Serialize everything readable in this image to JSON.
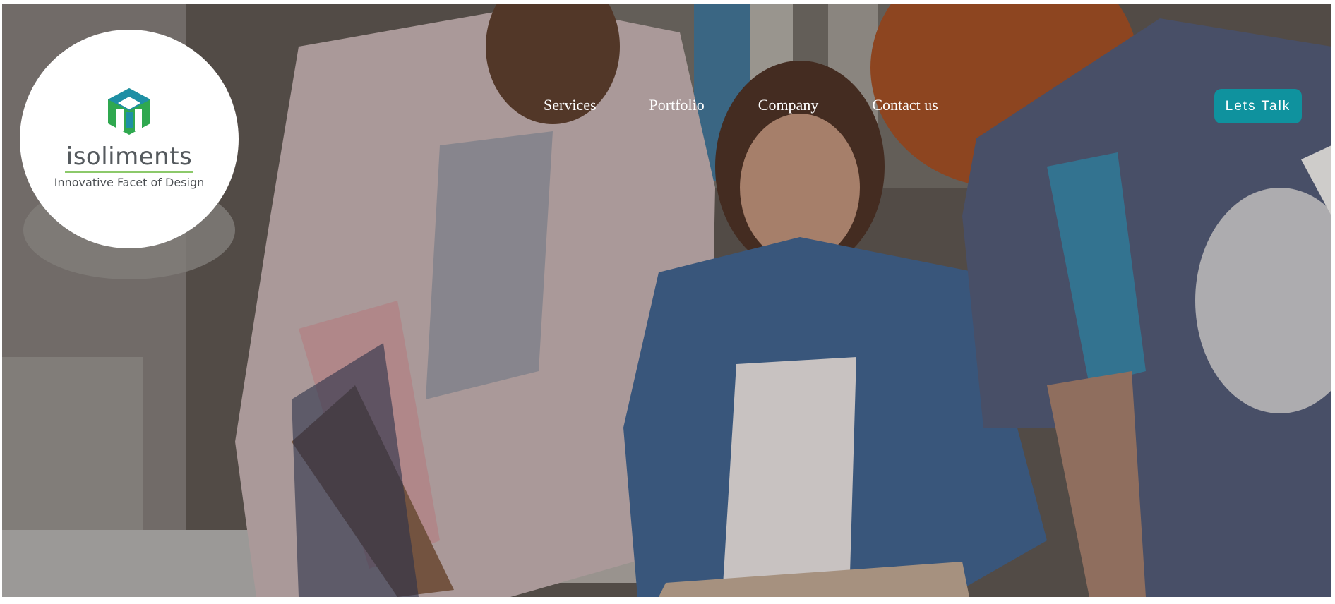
{
  "logo": {
    "wordmark": "isoliments",
    "tagline": "Innovative Facet of Design",
    "icon": "isoliments-logo-icon",
    "colors": {
      "green": "#2fa84f",
      "teal": "#1e8fa5",
      "rule": "#8cc96a"
    }
  },
  "nav": {
    "items": [
      {
        "label": "Services"
      },
      {
        "label": "Portfolio"
      },
      {
        "label": "Company"
      },
      {
        "label": "Contact us"
      }
    ]
  },
  "cta": {
    "label": "Lets Talk",
    "color": "#0f929e"
  },
  "hero": {
    "image": "team-working-at-desk-photo"
  }
}
